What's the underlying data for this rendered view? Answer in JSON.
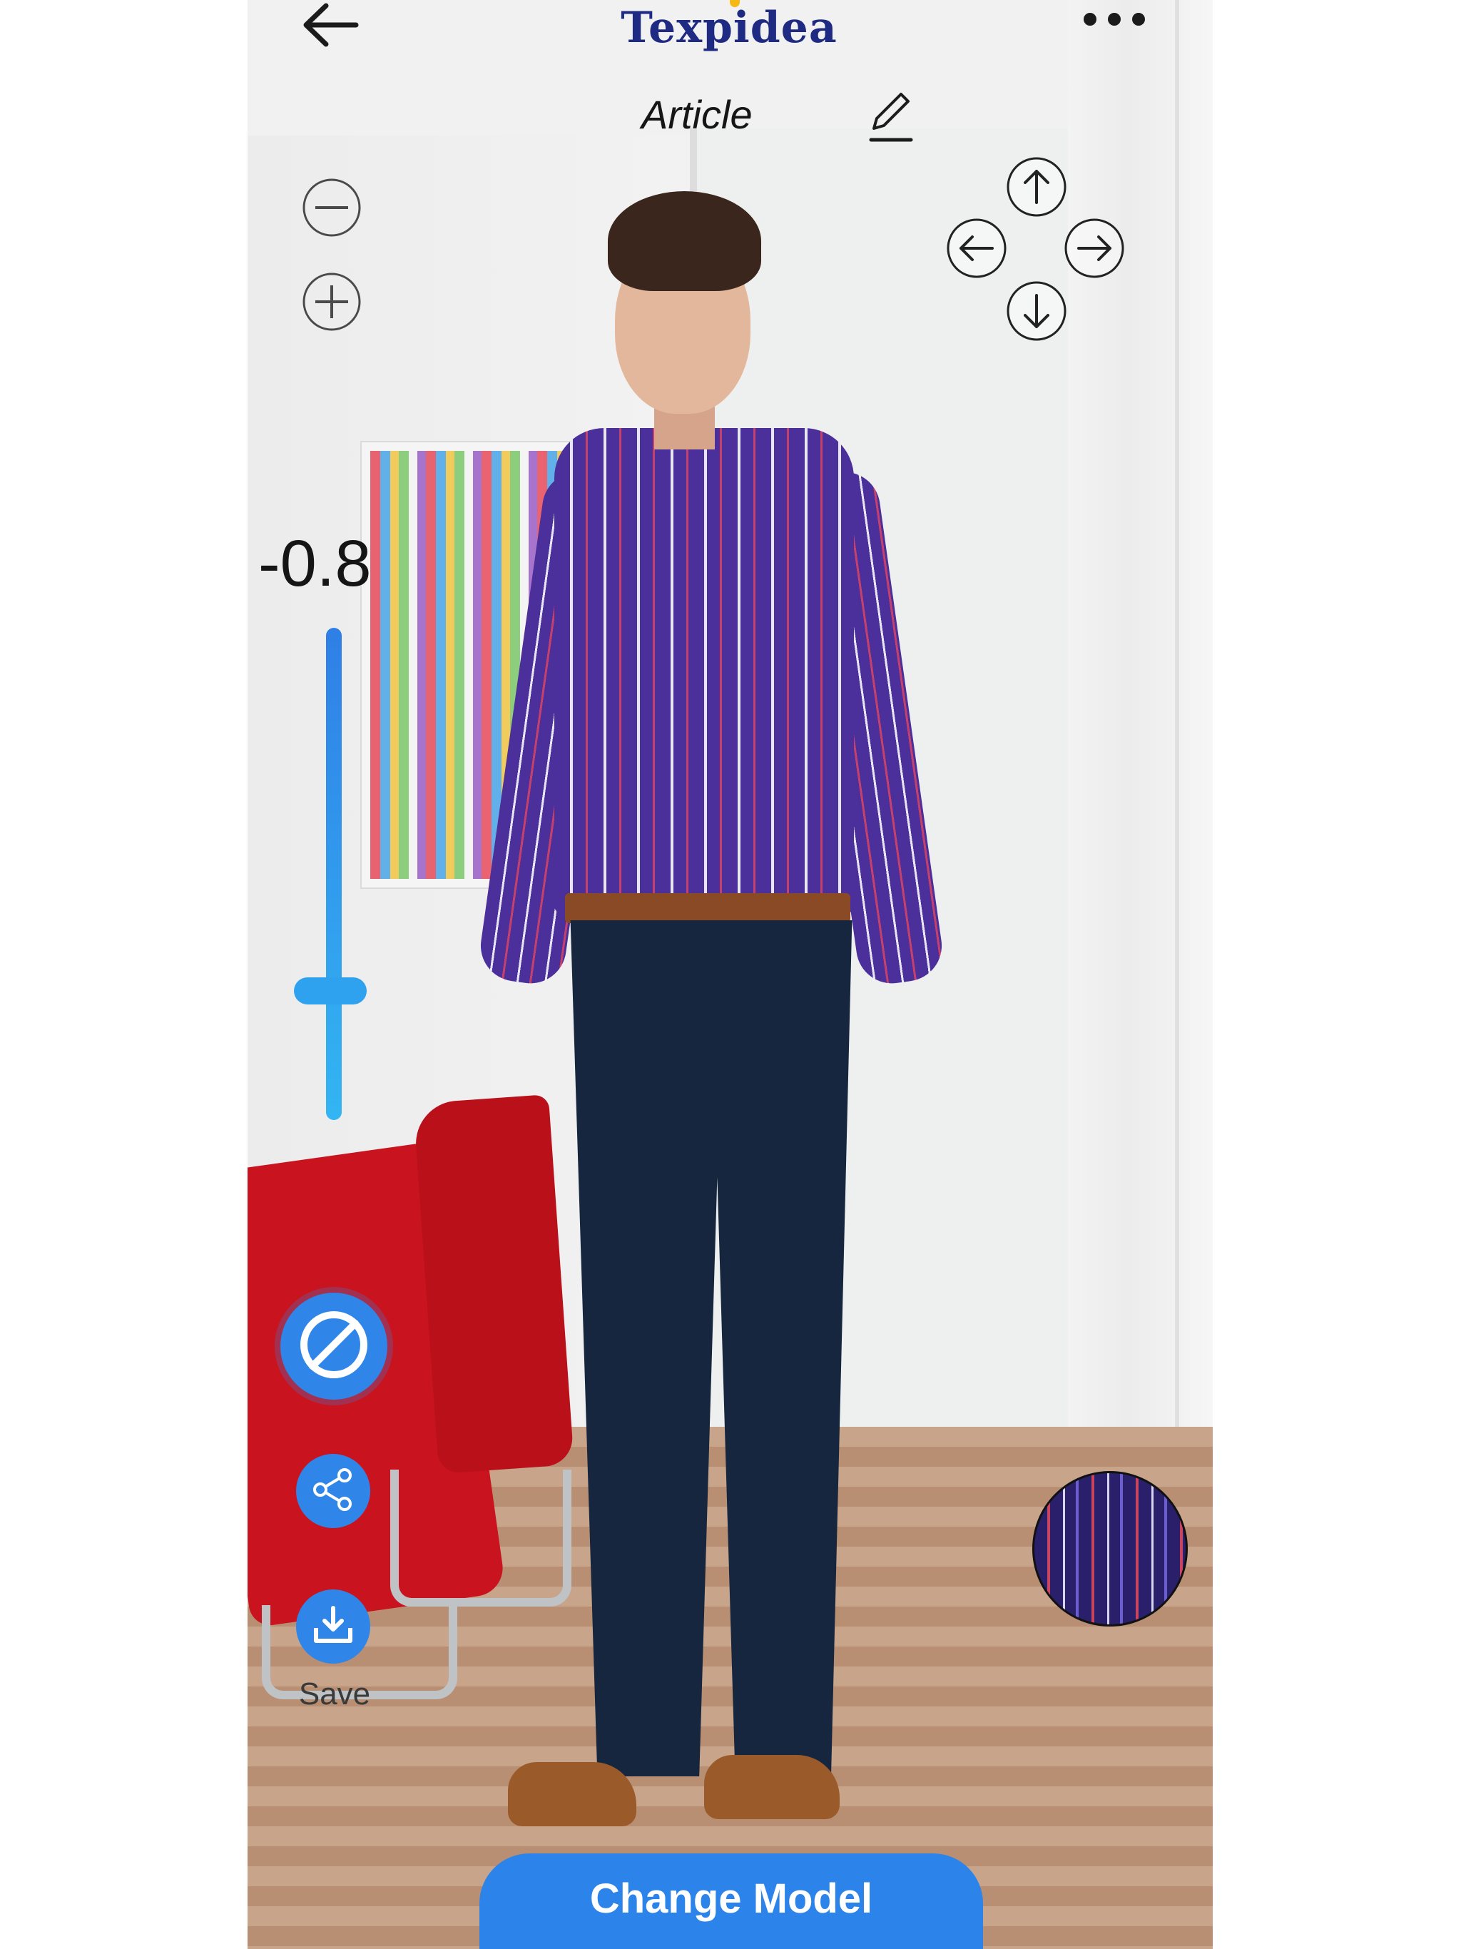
{
  "app": {
    "logo_text": "Texpidea",
    "brand_color": "#1f2a83",
    "accent_color": "#2c84ea"
  },
  "header": {
    "back_icon": "arrow-left-icon",
    "more_icon": "more-horizontal-icon",
    "article_label": "Article",
    "edit_icon": "pencil-icon"
  },
  "controls": {
    "zoom_out_icon": "minus-circle-icon",
    "zoom_in_icon": "plus-circle-icon",
    "direction_icons": [
      "arrow-up-circle-icon",
      "arrow-left-circle-icon",
      "arrow-right-circle-icon",
      "arrow-down-circle-icon"
    ],
    "slider_value": "-0.8"
  },
  "actions": {
    "block_icon": "block-icon",
    "share_icon": "share-icon",
    "save_icon": "download-icon",
    "save_label": "Save"
  },
  "swatch": {
    "name": "fabric-swatch",
    "colors": [
      "#2a1f6a",
      "#c9445f",
      "#d9d4ee",
      "#6b5fd0"
    ]
  },
  "footer": {
    "change_model_label": "Change Model"
  }
}
